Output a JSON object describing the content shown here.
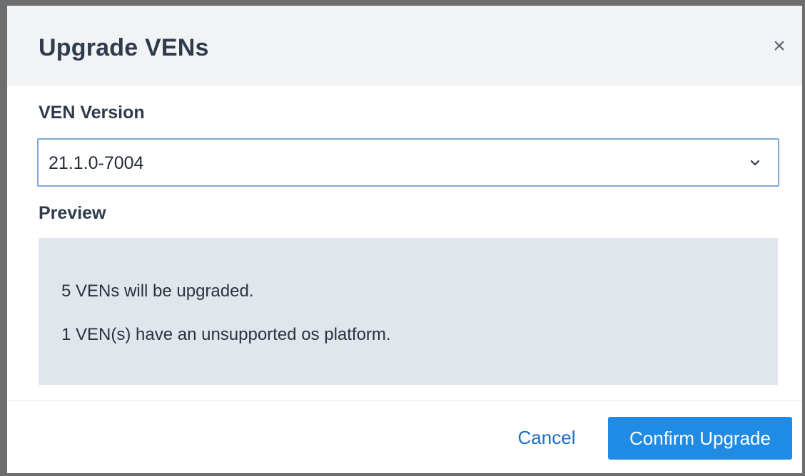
{
  "dialog": {
    "title": "Upgrade VENs",
    "close_icon": "close-icon",
    "close_glyph": "×"
  },
  "version_field": {
    "label": "VEN Version",
    "selected_value": "21.1.0-7004",
    "dropdown_icon": "chevron-down-icon"
  },
  "preview": {
    "label": "Preview",
    "lines": [
      "5 VENs will be upgraded.",
      "1 VEN(s) have an unsupported os platform."
    ]
  },
  "footer": {
    "cancel_label": "Cancel",
    "confirm_label": "Confirm Upgrade"
  },
  "colors": {
    "accent": "#1f8be5",
    "link": "#1d6fc0",
    "preview_background": "#e1e5ec",
    "header_background": "#f2f3f5",
    "select_border": "#7fa7d3"
  }
}
